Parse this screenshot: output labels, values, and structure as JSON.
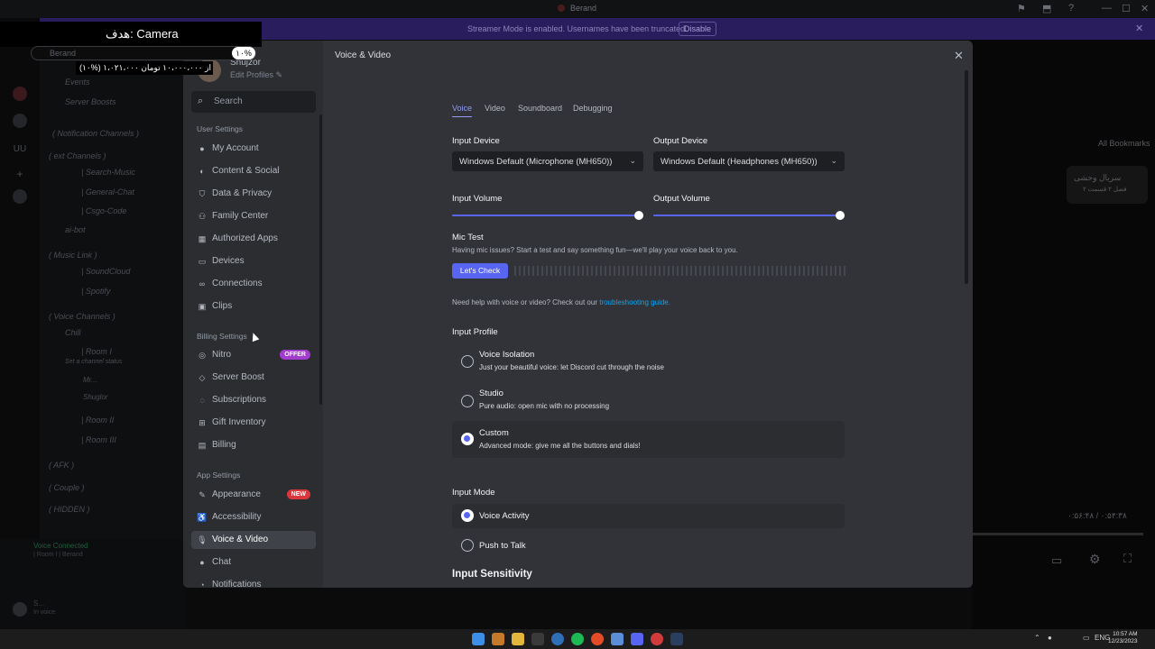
{
  "titlebar": {
    "title": "Berand"
  },
  "streamer_banner": {
    "text": "Streamer Mode is enabled. Usernames have been truncated.",
    "button": "Disable"
  },
  "overlay": {
    "camera_label": "هدف: Camera",
    "progress_percent": "۱۰%",
    "server_label": "Berand",
    "donation_text": "(۱۰%) ۱،۰۲۱،۰۰۰ از ۱۰،۰۰۰،۰۰۰ تومان"
  },
  "bg_channels": {
    "items": [
      "Events",
      "Server Boosts",
      "( Notification Channels )",
      "( ext Channels )",
      "| Search-Music",
      "| General-Chat",
      "| Csgo-Code",
      "ai-bot",
      "( Music Link )",
      "| SoundCloud",
      "| Spotify",
      "( Voice Channels )",
      "Chill",
      "| Room I",
      "Set a channel status",
      "Mr...",
      "Shuglor",
      "| Room II",
      "| Room III",
      "( AFK )",
      "( Couple )",
      "( HIDDEN )"
    ],
    "voice_connected": "Voice Connected",
    "voice_sub": "| Room I | Berand",
    "user": "S...",
    "user_status": "In voice"
  },
  "bg_right": {
    "bookmarks": "All Bookmarks",
    "series": "سریال وحشی",
    "series_sub": "فصل ۲ قسمت ۲",
    "time": "۰:۵۶:۴۸ / ۰:۵۴:۳۸"
  },
  "profile": {
    "name": "Shujzor",
    "edit": "Edit Profiles"
  },
  "sidebar": {
    "search_placeholder": "Search",
    "user_settings_header": "User Settings",
    "user_settings": [
      {
        "label": "My Account",
        "icon": "person"
      },
      {
        "label": "Content & Social",
        "icon": "content"
      },
      {
        "label": "Data & Privacy",
        "icon": "shield"
      },
      {
        "label": "Family Center",
        "icon": "family"
      },
      {
        "label": "Authorized Apps",
        "icon": "grid"
      },
      {
        "label": "Devices",
        "icon": "devices"
      },
      {
        "label": "Connections",
        "icon": "link"
      },
      {
        "label": "Clips",
        "icon": "clips"
      }
    ],
    "billing_header": "Billing Settings",
    "billing": [
      {
        "label": "Nitro",
        "icon": "nitro",
        "badge": "OFFER"
      },
      {
        "label": "Server Boost",
        "icon": "boost"
      },
      {
        "label": "Subscriptions",
        "icon": "subs"
      },
      {
        "label": "Gift Inventory",
        "icon": "gift"
      },
      {
        "label": "Billing",
        "icon": "billing"
      }
    ],
    "app_header": "App Settings",
    "app": [
      {
        "label": "Appearance",
        "icon": "brush",
        "badge": "NEW"
      },
      {
        "label": "Accessibility",
        "icon": "access"
      },
      {
        "label": "Voice & Video",
        "icon": "mic",
        "active": true
      },
      {
        "label": "Chat",
        "icon": "chat"
      },
      {
        "label": "Notifications",
        "icon": "bell"
      }
    ]
  },
  "main": {
    "title": "Voice & Video",
    "tabs": [
      "Voice",
      "Video",
      "Soundboard",
      "Debugging"
    ],
    "active_tab": "Voice",
    "input_device_label": "Input Device",
    "input_device_value": "Windows Default (Microphone (MH650))",
    "output_device_label": "Output Device",
    "output_device_value": "Windows Default (Headphones (MH650))",
    "input_volume_label": "Input Volume",
    "input_volume": 1.0,
    "output_volume_label": "Output Volume",
    "output_volume": 1.0,
    "mic_test_label": "Mic Test",
    "mic_test_desc": "Having mic issues? Start a test and say something fun—we'll play your voice back to you.",
    "mic_test_button": "Let's Check",
    "help_text": "Need help with voice or video? Check out our",
    "help_link": "troubleshooting guide.",
    "input_profile_label": "Input Profile",
    "profiles": [
      {
        "title": "Voice Isolation",
        "desc": "Just your beautiful voice: let Discord cut through the noise",
        "selected": false
      },
      {
        "title": "Studio",
        "desc": "Pure audio: open mic with no processing",
        "selected": false
      },
      {
        "title": "Custom",
        "desc": "Advanced mode: give me all the buttons and dials!",
        "selected": true
      }
    ],
    "input_mode_label": "Input Mode",
    "modes": [
      {
        "title": "Voice Activity",
        "selected": true
      },
      {
        "title": "Push to Talk",
        "selected": false
      }
    ],
    "input_sensitivity_label": "Input Sensitivity"
  },
  "taskbar": {
    "time": "10:57 AM",
    "date": "12/23/2023",
    "lang": "ENG"
  },
  "colors": {
    "accent": "#5865f2",
    "offer_badge": "#a13ccf",
    "new_badge": "#da373c",
    "link": "#00a8fc"
  }
}
